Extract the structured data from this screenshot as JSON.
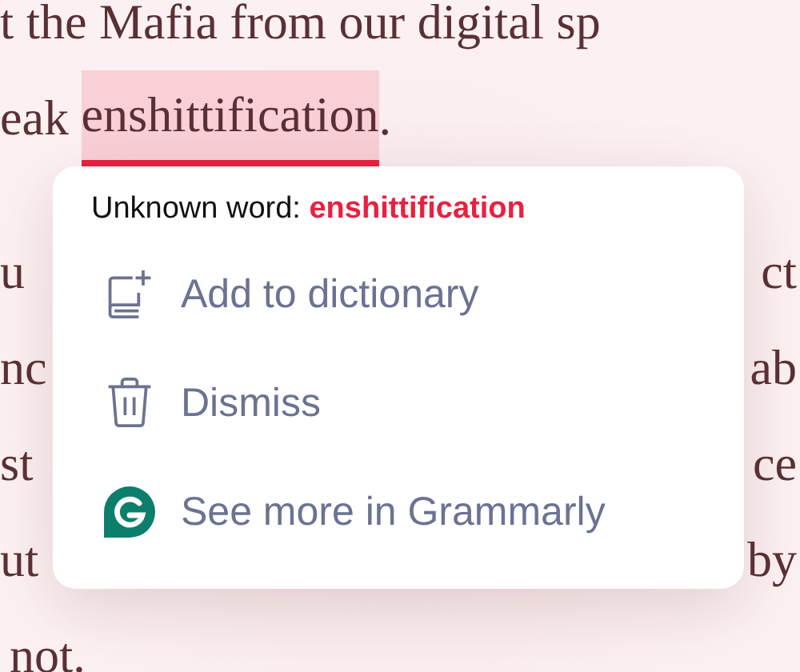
{
  "document_lines": [
    {
      "kind": "full",
      "text": "t the Mafia from our digital sp"
    },
    {
      "kind": "flagged",
      "before": "eak ",
      "flagged": "enshittification",
      "after": "."
    },
    {
      "kind": "split",
      "left": "u",
      "right": "ct"
    },
    {
      "kind": "split",
      "left": "nc",
      "right": "ab"
    },
    {
      "kind": "split",
      "left": "st",
      "right": "ce"
    },
    {
      "kind": "split",
      "left": "ut",
      "right": "by"
    },
    {
      "kind": "full",
      "text": "not."
    }
  ],
  "popup": {
    "label": "Unknown word:",
    "word": "enshittification",
    "actions": [
      {
        "kind": "add",
        "label": "Add to dictionary"
      },
      {
        "kind": "dismiss",
        "label": "Dismiss"
      },
      {
        "kind": "grammarly",
        "label": "See more in Grammarly"
      }
    ]
  }
}
